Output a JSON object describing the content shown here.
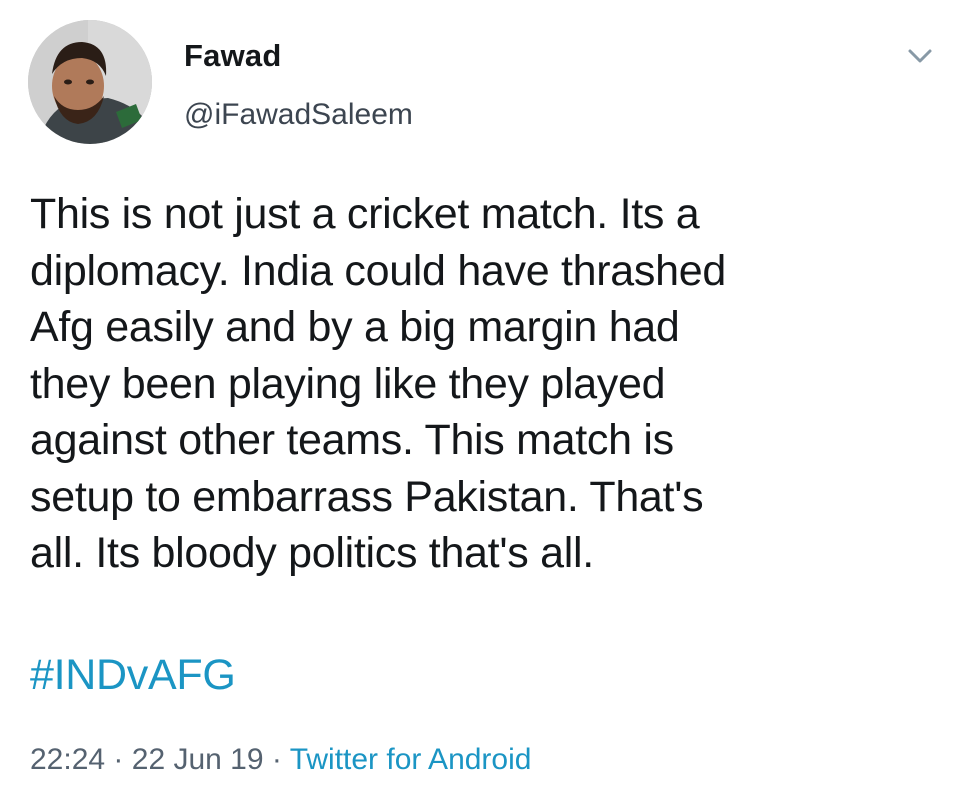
{
  "user": {
    "name": "Fawad",
    "handle": "@iFawadSaleem"
  },
  "tweet": {
    "text": "This is not just a cricket match. Its a\ndiplomacy. India could have thrashed\nAfg easily and by a big margin had\nthey been playing like they played\nagainst other teams. This match is\nsetup to embarrass Pakistan. That's\nall. Its bloody politics that's all.",
    "hashtag": "#INDvAFG"
  },
  "meta": {
    "time": "22:24",
    "separator": "·",
    "date": "22 Jun 19",
    "client": "Twitter for Android"
  },
  "icons": {
    "menu": "chevron-down-icon",
    "avatar": "avatar"
  },
  "colors": {
    "link": "#1b95c4",
    "text": "#14171a",
    "secondary": "#556270"
  }
}
